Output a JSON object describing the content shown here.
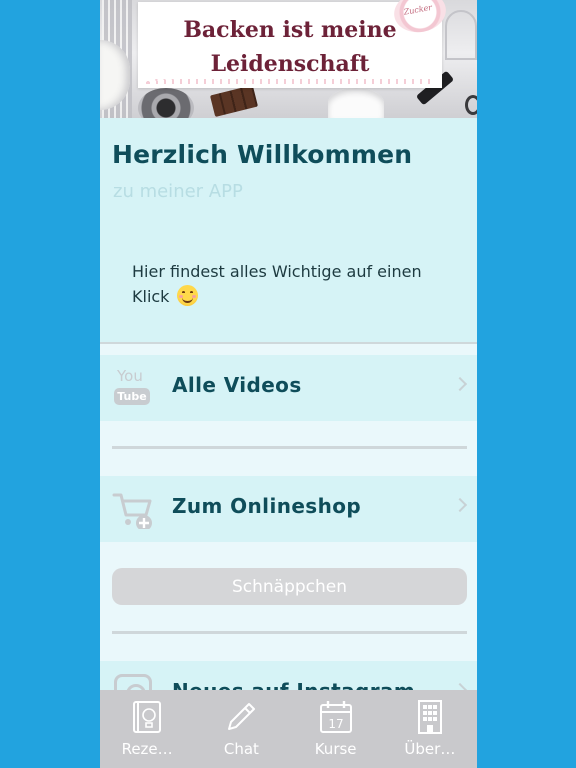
{
  "banner": {
    "title": "Backen ist meine\nLeidenschaft"
  },
  "welcome": {
    "title": "Herzlich Willkommen",
    "subtitle": "zu meiner APP",
    "text": "Hier findest alles Wichtige auf einen Klick"
  },
  "menu": {
    "videos": {
      "label": "Alle Videos",
      "icon": "youtube-icon"
    },
    "shop": {
      "label": "Zum Onlineshop",
      "icon": "cart-icon"
    },
    "bargain_button": "Schnäppchen",
    "instagram": {
      "label": "Neues auf Instagram",
      "icon": "instagram-icon"
    }
  },
  "tabbar": {
    "tabs": [
      {
        "label": "Reze…",
        "icon": "recipe-book-icon"
      },
      {
        "label": "Chat",
        "icon": "pencil-icon"
      },
      {
        "label": "Kurse",
        "icon": "calendar-icon",
        "icon_text": "17"
      },
      {
        "label": "Über…",
        "icon": "building-icon"
      }
    ]
  },
  "colors": {
    "outer_background": "#22a3df",
    "accent_text": "#0f4d5a",
    "banner_title": "#6d2238",
    "tabbar": "#c9c9cc"
  }
}
